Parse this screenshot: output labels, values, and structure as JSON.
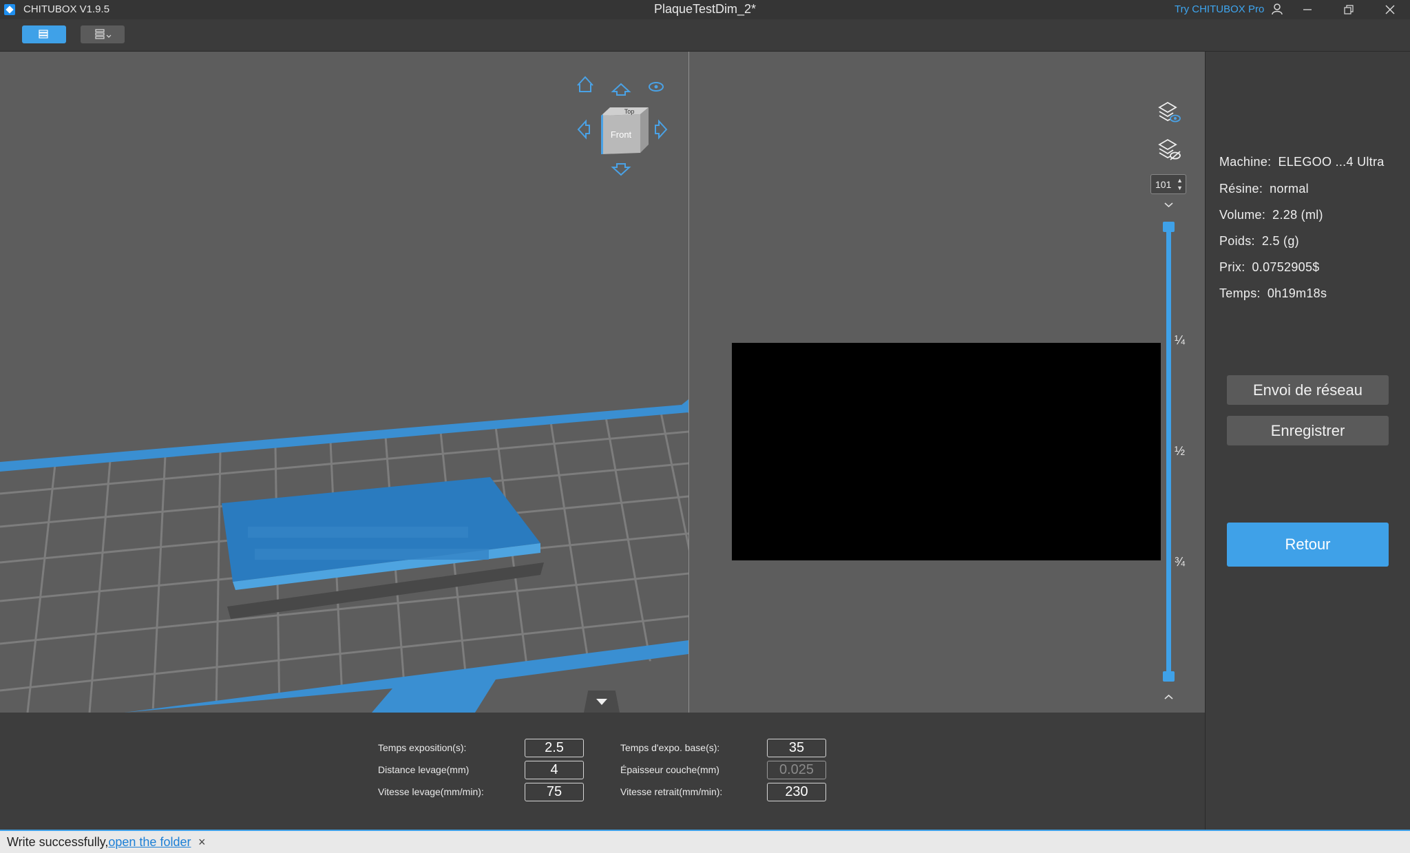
{
  "titlebar": {
    "app_name": "CHITUBOX V1.9.5",
    "document_title": "PlaqueTestDim_2*",
    "try_pro": "Try CHITUBOX Pro"
  },
  "toolbar": {
    "slice_tab_icon": "slice-print-icon",
    "slices_menu_icon": "layers-stack-icon"
  },
  "viewcube": {
    "face_label": "Front",
    "top_label": "Top"
  },
  "layer_slider": {
    "current_layer": "101",
    "ticks": [
      "¼",
      "½",
      "¾"
    ]
  },
  "info": {
    "machine_label": "Machine:",
    "machine_value": "ELEGOO ...4 Ultra",
    "resin_label": "Résine:",
    "resin_value": "normal",
    "volume_label": "Volume:",
    "volume_value": "2.28  (ml)",
    "weight_label": "Poids:",
    "weight_value": "2.5  (g)",
    "price_label": "Prix:",
    "price_value": "0.0752905$",
    "time_label": "Temps:",
    "time_value": "0h19m18s"
  },
  "actions": {
    "network_send": "Envoi de réseau",
    "save": "Enregistrer",
    "back": "Retour"
  },
  "settings": {
    "exposure_label": "Temps exposition(s):",
    "exposure_value": "2.5",
    "lift_distance_label": "Distance levage(mm)",
    "lift_distance_value": "4",
    "lift_speed_label": "Vitesse levage(mm/min):",
    "lift_speed_value": "75",
    "base_exposure_label": "Temps d'expo. base(s):",
    "base_exposure_value": "35",
    "layer_thickness_label": "Épaisseur couche(mm)",
    "layer_thickness_value": "0.025",
    "retract_speed_label": "Vitesse retrait(mm/min):",
    "retract_speed_value": "230"
  },
  "status": {
    "message": "Write successfully,",
    "link": "open the folder",
    "close": "×"
  },
  "colors": {
    "accent": "#3fa1e8",
    "viewport_bg": "#5d5d5d",
    "panel_bg": "#3d3d3d",
    "model": "#2a7bbf"
  }
}
